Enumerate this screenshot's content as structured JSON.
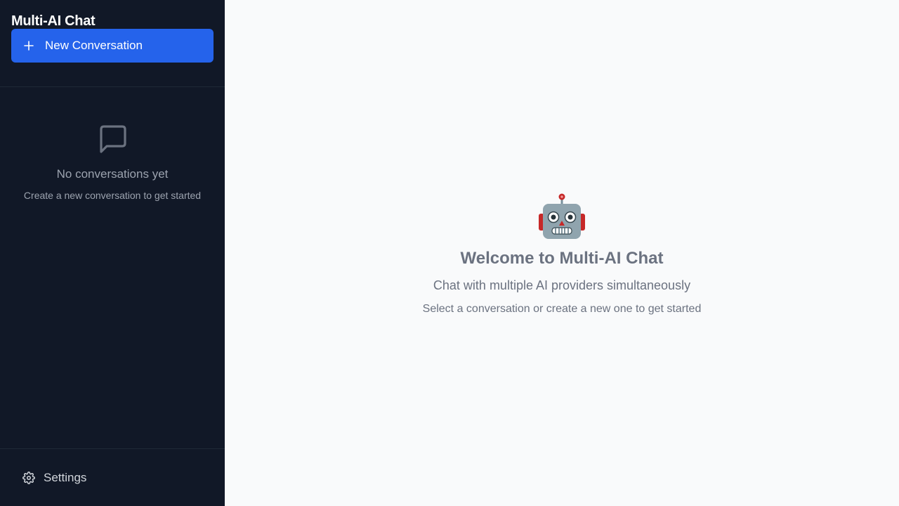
{
  "app": {
    "title": "Multi-AI Chat"
  },
  "sidebar": {
    "new_conversation_label": "New Conversation",
    "new_conversation_icon": "plus-icon",
    "empty_state": {
      "icon": "message-square-icon",
      "title": "No conversations yet",
      "subtitle": "Create a new conversation to get started"
    },
    "settings_label": "Settings",
    "settings_icon": "gear-icon"
  },
  "main": {
    "welcome_icon": "robot-emoji",
    "welcome_title": "Welcome to Multi-AI Chat",
    "welcome_subtitle": "Chat with multiple AI providers simultaneously",
    "welcome_hint": "Select a conversation or create a new one to get started"
  },
  "colors": {
    "sidebar_bg": "#111827",
    "accent": "#2563eb",
    "main_bg": "#f9fafb",
    "muted_text": "#6b7280"
  }
}
